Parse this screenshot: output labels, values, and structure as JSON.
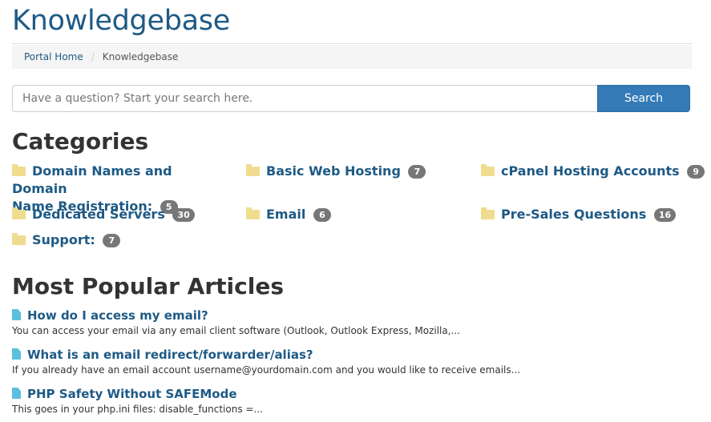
{
  "page": {
    "title": "Knowledgebase"
  },
  "breadcrumb": {
    "home": "Portal Home",
    "separator": "/",
    "current": "Knowledgebase"
  },
  "search": {
    "placeholder": "Have a question? Start your search here.",
    "button_label": "Search"
  },
  "categories": {
    "heading": "Categories",
    "items": [
      {
        "name_line1": "Domain Names and Domain",
        "name_line2": "Name Registration:",
        "count": "5"
      },
      {
        "name": "Basic Web Hosting",
        "count": "7"
      },
      {
        "name": "cPanel Hosting Accounts",
        "count": "9"
      },
      {
        "name": "Dedicated Servers",
        "count": "30"
      },
      {
        "name": "Email",
        "count": "6"
      },
      {
        "name": "Pre-Sales Questions",
        "count": "16"
      },
      {
        "name": "Support:",
        "count": "7"
      }
    ]
  },
  "popular": {
    "heading": "Most Popular Articles",
    "articles": [
      {
        "title": "How do I access my email?",
        "excerpt": "You can access your email via any email client software (Outlook, Outlook Express, Mozilla,..."
      },
      {
        "title": "What is an email redirect/forwarder/alias?",
        "excerpt": "If you already have an email account username@yourdomain.com and you would like to receive emails..."
      },
      {
        "title": "PHP Safety Without SAFEMode",
        "excerpt": "This goes in your php.ini files: disable_functions =..."
      }
    ]
  },
  "colors": {
    "link": "#1e5a85",
    "button": "#337ab7",
    "badge": "#777777",
    "folder": "#f0dc8e",
    "doc": "#5bc0de"
  }
}
